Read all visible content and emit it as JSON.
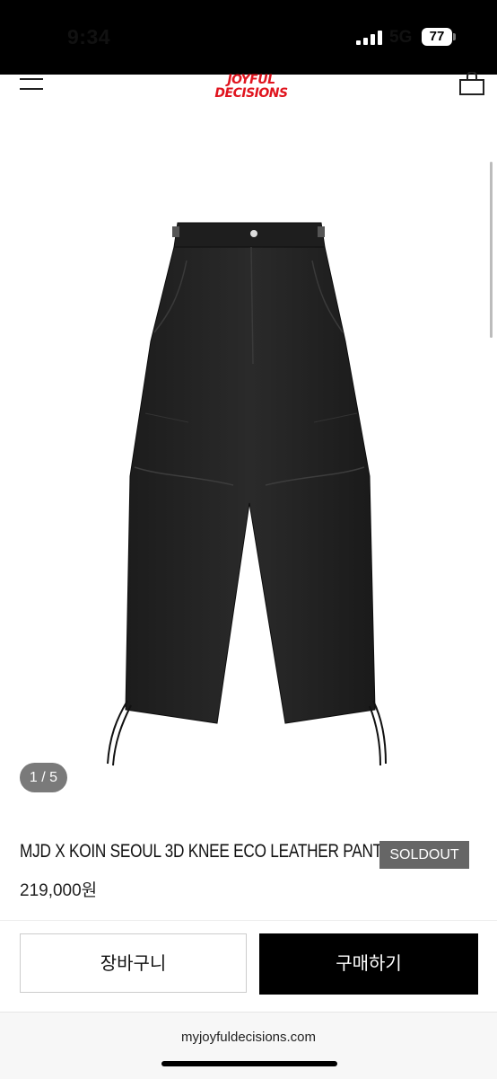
{
  "status_bar": {
    "time": "9:34",
    "network": "5G",
    "battery": "77"
  },
  "header": {
    "logo_line1": "JOYFUL",
    "logo_line2": "DECISIONS",
    "brand_color": "#e0141e",
    "menu_icon": "hamburger-menu-icon",
    "cart_icon": "shopping-bag-icon"
  },
  "gallery": {
    "counter": "1 / 5"
  },
  "product": {
    "title": "MJD X KOIN SEOUL 3D KNEE ECO LEATHER PANTS",
    "badge": "SOLDOUT",
    "price": "219,000원"
  },
  "actions": {
    "cart_label": "장바구니",
    "buy_label": "구매하기"
  },
  "browser": {
    "url": "myjoyfuldecisions.com"
  }
}
